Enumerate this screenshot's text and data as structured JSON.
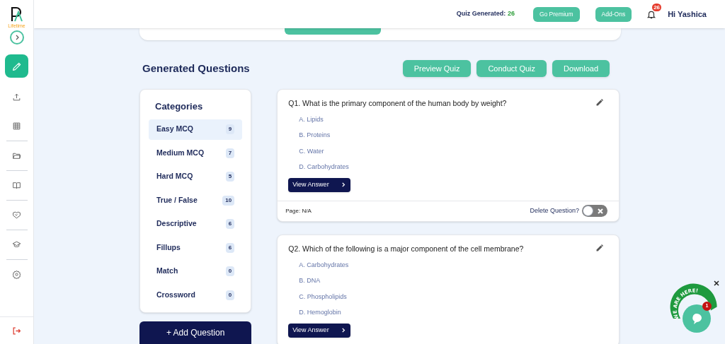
{
  "sidebar": {
    "logo_caption": "Lifetime",
    "items": [
      {
        "selected": true
      },
      {
        "selected": false
      },
      {
        "selected": false
      },
      {
        "selected": false
      },
      {
        "selected": false
      },
      {
        "selected": false
      },
      {
        "selected": false
      },
      {
        "selected": false
      }
    ]
  },
  "header": {
    "quiz_label": "Quiz Generated:",
    "quiz_count": "26",
    "buttons": [
      "Go Premium",
      "Add-Ons"
    ],
    "notification_count": "26",
    "greeting": "Hi Yashica"
  },
  "section_title": "Generated Questions",
  "actions": [
    "Preview Quiz",
    "Conduct Quiz",
    "Download"
  ],
  "categories": {
    "title": "Categories",
    "items": [
      {
        "label": "Easy MCQ",
        "count": "9",
        "selected": true
      },
      {
        "label": "Medium MCQ",
        "count": "7",
        "selected": false
      },
      {
        "label": "Hard MCQ",
        "count": "5",
        "selected": false
      },
      {
        "label": "True / False",
        "count": "10",
        "selected": false
      },
      {
        "label": "Descriptive",
        "count": "6",
        "selected": false
      },
      {
        "label": "Fillups",
        "count": "6",
        "selected": false
      },
      {
        "label": "Match",
        "count": "0",
        "selected": false
      },
      {
        "label": "Crossword",
        "count": "0",
        "selected": false
      }
    ]
  },
  "add_question": "+ Add Question",
  "questions": [
    {
      "text": "Q1. What is the primary component of the human body by weight?",
      "options": [
        "A. Lipids",
        "B. Proteins",
        "C. Water",
        "D. Carbohydrates"
      ],
      "view_answer": "View Answer",
      "page": "Page: N/A",
      "delete_label": "Delete Question?",
      "delete_on": false
    },
    {
      "text": "Q2. Which of the following is a major component of the cell membrane?",
      "options": [
        "A. Carbohydrates",
        "B. DNA",
        "C. Phospholipids",
        "D. Hemoglobin"
      ],
      "view_answer": "View Answer"
    }
  ],
  "chat": {
    "banner": "WE ARE HERE!",
    "badge": "1"
  }
}
